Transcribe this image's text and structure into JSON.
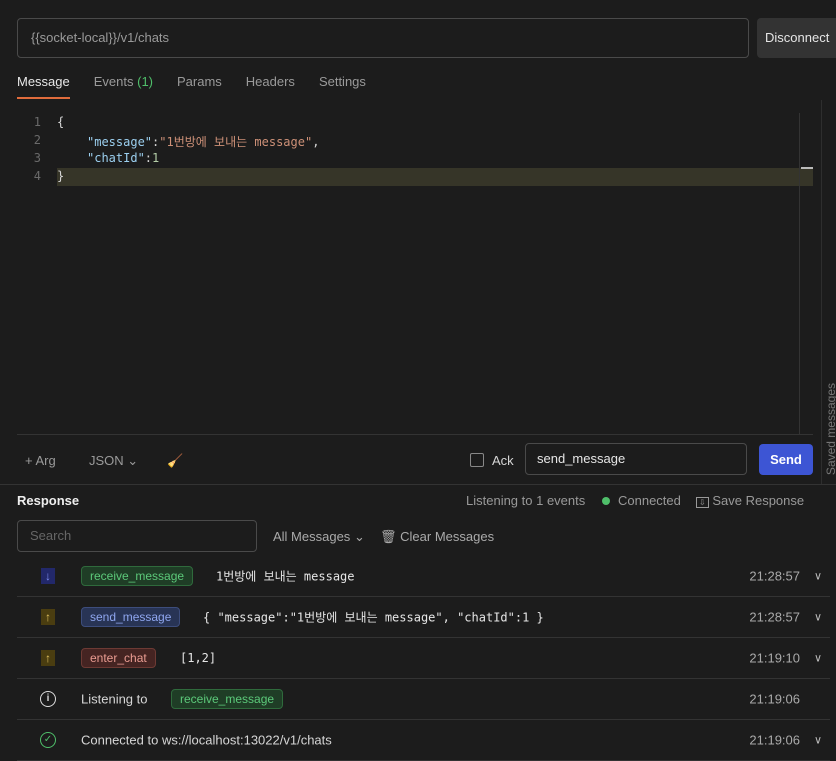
{
  "url": {
    "value": "{{socket-local}}/v1/chats",
    "disconnect": "Disconnect"
  },
  "tabs": [
    {
      "label": "Message"
    },
    {
      "label": "Events ",
      "count": "(1)"
    },
    {
      "label": "Params"
    },
    {
      "label": "Headers"
    },
    {
      "label": "Settings"
    }
  ],
  "editor": {
    "line_numbers": [
      "1",
      "2",
      "3",
      "4"
    ],
    "lines": {
      "l1": "{",
      "l2_key": "\"message\"",
      "l2_val": "\"1번방에 보내는 message\"",
      "l3_key": "\"chatId\"",
      "l3_val": "1",
      "l4": "}"
    }
  },
  "toolbar": {
    "arg": "+ Arg",
    "format": "JSON",
    "ack": "Ack",
    "event_name": "send_message",
    "send": "Send"
  },
  "side_panel": "Saved messages",
  "response": {
    "title": "Response",
    "listening": "Listening to 1 events",
    "status": "Connected",
    "status_color": "#4fbf6a",
    "save": "Save Response",
    "search_placeholder": "Search",
    "filter": "All Messages",
    "clear": "Clear Messages"
  },
  "messages": [
    {
      "direction": "down",
      "event": "receive_message",
      "body": "1번방에 보내는 message",
      "time": "21:28:57"
    },
    {
      "direction": "up",
      "event": "send_message",
      "body": "{ \"message\":\"1번방에 보내는 message\", \"chatId\":1 }",
      "time": "21:28:57"
    },
    {
      "direction": "up",
      "event": "enter_chat",
      "body": "[1,2]",
      "time": "21:19:10"
    },
    {
      "type": "info",
      "text": "Listening to",
      "event": "receive_message",
      "time": "21:19:06"
    },
    {
      "type": "connected",
      "text": "Connected to ws://localhost:13022/v1/chats",
      "time": "21:19:06"
    }
  ]
}
